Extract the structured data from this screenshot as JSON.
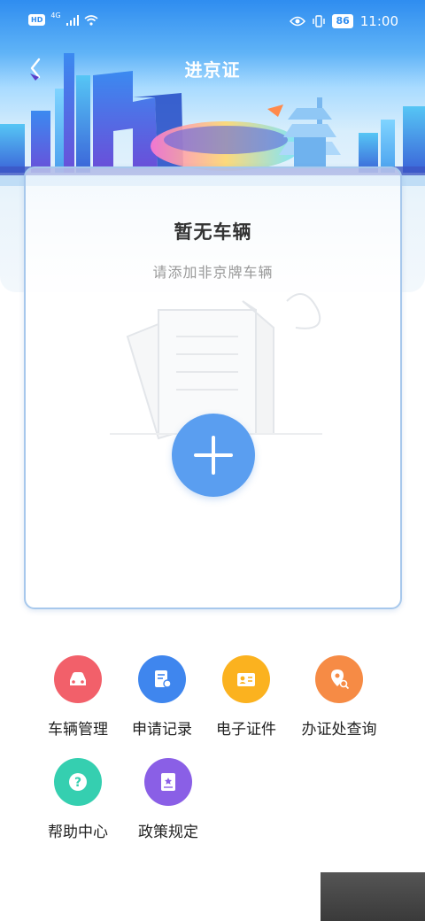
{
  "status_bar": {
    "hd": "HD",
    "network": "4G",
    "battery": "86",
    "time": "11:00"
  },
  "nav": {
    "title": "进京证"
  },
  "card": {
    "title": "暂无车辆",
    "subtitle": "请添加非京牌车辆"
  },
  "menu": [
    {
      "label": "车辆管理",
      "icon": "car-icon",
      "color": "#f2606a"
    },
    {
      "label": "申请记录",
      "icon": "document-icon",
      "color": "#3f86ee"
    },
    {
      "label": "电子证件",
      "icon": "id-card-icon",
      "color": "#fbb21f"
    },
    {
      "label": "办证处查询",
      "icon": "location-search-icon",
      "color": "#f68b45"
    },
    {
      "label": "帮助中心",
      "icon": "help-icon",
      "color": "#35cfb0"
    },
    {
      "label": "政策规定",
      "icon": "book-icon",
      "color": "#8a5fe6"
    }
  ]
}
